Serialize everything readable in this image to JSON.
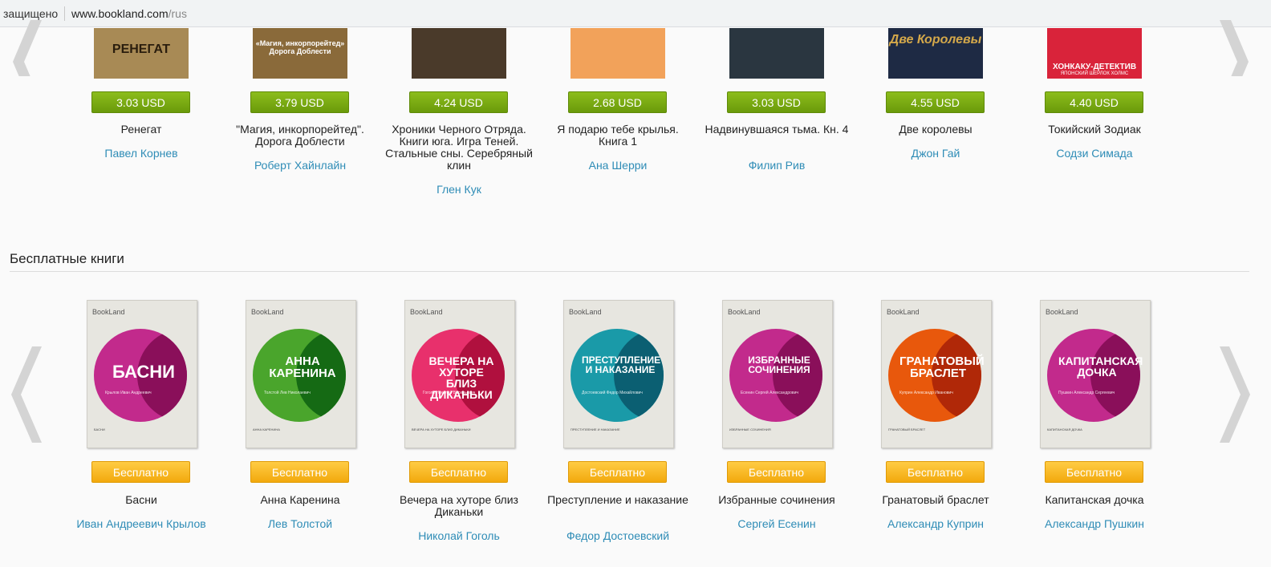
{
  "browser": {
    "secure_label": "защищено",
    "url_host": "www.bookland.com",
    "url_path": "/rus"
  },
  "top_row": [
    {
      "price": "3.03 USD",
      "title": "Ренегат",
      "author": "Павел Корнев",
      "cover_text": "РЕНЕГАТ",
      "cover_color": "#a88a55"
    },
    {
      "price": "3.79 USD",
      "title": "\"Магия, инкорпорейтед\". Дорога Доблести",
      "author": "Роберт Хайнлайн",
      "cover_text": "«Магия, инкорпорейтед» Дорога Доблести",
      "cover_color": "#8a6a3a"
    },
    {
      "price": "4.24 USD",
      "title": "Хроники Черного Отряда. Книги юга. Игра Теней. Стальные сны. Серебряный клин",
      "author": "Глен Кук",
      "cover_text": "",
      "cover_color": "#4a3a2a"
    },
    {
      "price": "2.68 USD",
      "title": "Я подарю тебе крылья. Книга 1",
      "author": "Ана Шерри",
      "cover_text": "",
      "cover_color": "#f2a25a"
    },
    {
      "price": "3.03 USD",
      "title": "Надвинувшаяся тьма. Кн. 4",
      "author": "Филип Рив",
      "cover_text": "",
      "cover_color": "#2a3640"
    },
    {
      "price": "4.55 USD",
      "title": "Две королевы",
      "author": "Джон Гай",
      "cover_text": "Две Королевы",
      "cover_color": "#1e2a44"
    },
    {
      "price": "4.40 USD",
      "title": "Токийский Зодиак",
      "author": "Содзи Симада",
      "cover_text": "ХОНКАКУ-ДЕТЕКТИВ",
      "cover_sub": "ЯПОНСКИЙ ШЕРЛОК ХОЛМС",
      "cover_color": "#d9233a"
    }
  ],
  "free_section": {
    "title": "Бесплатные книги",
    "cover_brand": "BookLand",
    "books": [
      {
        "price": "Бесплатно",
        "title": "Басни",
        "author": "Иван Андреевич Крылов",
        "cover_title": "БАСНИ",
        "cover_sub": "Крылов Иван Андреевич",
        "circle_color": "#c22a8c",
        "overlap_color": "#8a0f5a"
      },
      {
        "price": "Бесплатно",
        "title": "Анна Каренина",
        "author": "Лев Толстой",
        "cover_title": "АННА КАРЕНИНА",
        "cover_sub": "Толстой Лев Николаевич",
        "circle_color": "#4aa52c",
        "overlap_color": "#156a14"
      },
      {
        "price": "Бесплатно",
        "title": "Вечера на хуторе близ Диканьки",
        "author": "Николай Гоголь",
        "cover_title": "ВЕЧЕРА НА ХУТОРЕ БЛИЗ ДИКАНЬКИ",
        "cover_sub": "Гоголь Николай Васильевич",
        "circle_color": "#e8306c",
        "overlap_color": "#b0103e"
      },
      {
        "price": "Бесплатно",
        "title": "Преступление и наказание",
        "author": "Федор Достоевский",
        "cover_title": "ПРЕСТУПЛЕНИЕ И НАКАЗАНИЕ",
        "cover_sub": "Достоевский Федор Михайлович",
        "circle_color": "#1a9aa8",
        "overlap_color": "#0b5f72"
      },
      {
        "price": "Бесплатно",
        "title": "Избранные сочинения",
        "author": "Сергей Есенин",
        "cover_title": "ИЗБРАННЫЕ СОЧИНЕНИЯ",
        "cover_sub": "Есенин Сергей Александрович",
        "circle_color": "#c22a8c",
        "overlap_color": "#8a0f5a"
      },
      {
        "price": "Бесплатно",
        "title": "Гранатовый браслет",
        "author": "Александр Куприн",
        "cover_title": "ГРАНАТОВЫЙ БРАСЛЕТ",
        "cover_sub": "Куприн Александр Иванович",
        "circle_color": "#e8580c",
        "overlap_color": "#b02808"
      },
      {
        "price": "Бесплатно",
        "title": "Капитанская дочка",
        "author": "Александр Пушкин",
        "cover_title": "КАПИТАНСКАЯ ДОЧКА",
        "cover_sub": "Пушкин Александр Сергеевич",
        "circle_color": "#c22a8c",
        "overlap_color": "#8a0f5a"
      }
    ]
  },
  "icons": {
    "prev": "chevron-left-icon",
    "next": "chevron-right-icon"
  }
}
